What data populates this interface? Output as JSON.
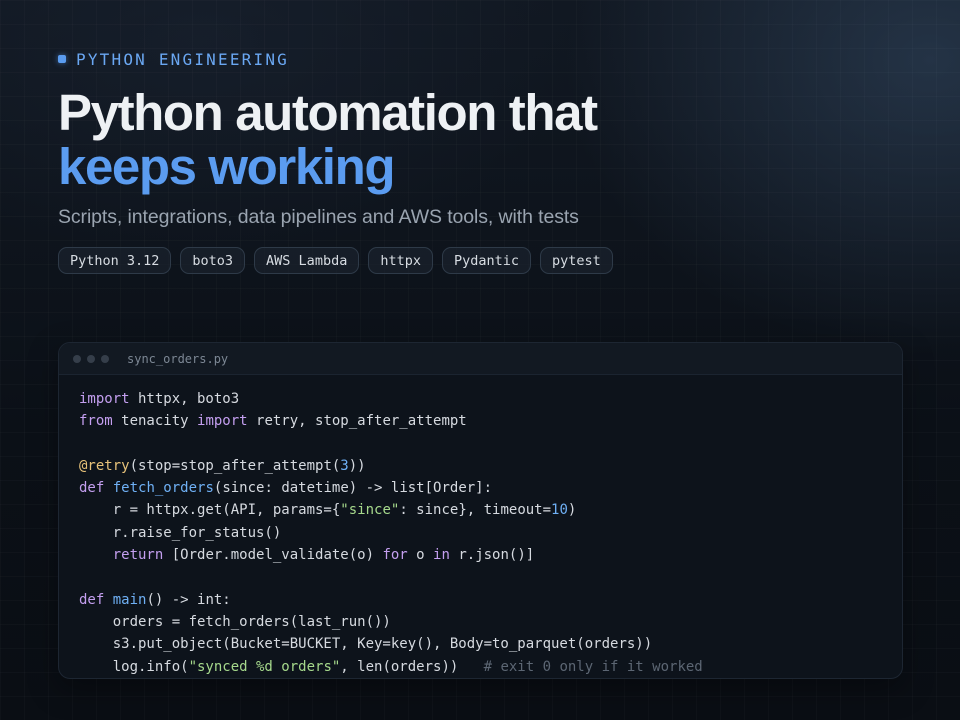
{
  "eyebrow": "PYTHON ENGINEERING",
  "title": {
    "line1": "Python automation that",
    "line2": "keeps working"
  },
  "subtitle": "Scripts, integrations, data pipelines and AWS tools, with tests",
  "tags": [
    "Python 3.12",
    "boto3",
    "AWS Lambda",
    "httpx",
    "Pydantic",
    "pytest"
  ],
  "code_window": {
    "file_name": "sync_orders.py",
    "lines": [
      [
        {
          "t": "import",
          "k": "kw"
        },
        {
          "t": " httpx, boto3",
          "k": ""
        }
      ],
      [
        {
          "t": "from",
          "k": "kw"
        },
        {
          "t": " tenacity ",
          "k": ""
        },
        {
          "t": "import",
          "k": "kw"
        },
        {
          "t": " retry, stop_after_attempt",
          "k": ""
        }
      ],
      [],
      [
        {
          "t": "@retry",
          "k": "dec"
        },
        {
          "t": "(stop=stop_after_attempt(",
          "k": ""
        },
        {
          "t": "3",
          "k": "num"
        },
        {
          "t": "))",
          "k": ""
        }
      ],
      [
        {
          "t": "def",
          "k": "kw"
        },
        {
          "t": " ",
          "k": ""
        },
        {
          "t": "fetch_orders",
          "k": "fn"
        },
        {
          "t": "(since: datetime) -> list[Order]:",
          "k": ""
        }
      ],
      [
        {
          "t": "    r = httpx.get(API, params={",
          "k": ""
        },
        {
          "t": "\"since\"",
          "k": "str"
        },
        {
          "t": ": since}, timeout=",
          "k": ""
        },
        {
          "t": "10",
          "k": "num"
        },
        {
          "t": ")",
          "k": ""
        }
      ],
      [
        {
          "t": "    r.raise_for_status()",
          "k": ""
        }
      ],
      [
        {
          "t": "    ",
          "k": ""
        },
        {
          "t": "return",
          "k": "kw"
        },
        {
          "t": " [Order.model_validate(o) ",
          "k": ""
        },
        {
          "t": "for",
          "k": "kw"
        },
        {
          "t": " o ",
          "k": ""
        },
        {
          "t": "in",
          "k": "kw"
        },
        {
          "t": " r.json()]",
          "k": ""
        }
      ],
      [],
      [
        {
          "t": "def",
          "k": "kw"
        },
        {
          "t": " ",
          "k": ""
        },
        {
          "t": "main",
          "k": "fn"
        },
        {
          "t": "() -> int:",
          "k": ""
        }
      ],
      [
        {
          "t": "    orders = fetch_orders(last_run())",
          "k": ""
        }
      ],
      [
        {
          "t": "    s3.put_object(Bucket=BUCKET, Key=key(), Body=to_parquet(orders))",
          "k": ""
        }
      ],
      [
        {
          "t": "    log.info(",
          "k": ""
        },
        {
          "t": "\"synced %d orders\"",
          "k": "str"
        },
        {
          "t": ", len(orders))   ",
          "k": ""
        },
        {
          "t": "# exit 0 only if it worked",
          "k": "cmt"
        }
      ]
    ]
  },
  "colors": {
    "accent": "#5b9cf0",
    "background": "#0b1017",
    "keyword": "#c49ff0",
    "function": "#6fb0f5",
    "decorator": "#e8c37a",
    "string": "#a6d98c",
    "comment": "#5c6673"
  },
  "icons": {
    "eyebrow": "square-bullet-icon",
    "window_controls": "window-dot-icon"
  }
}
